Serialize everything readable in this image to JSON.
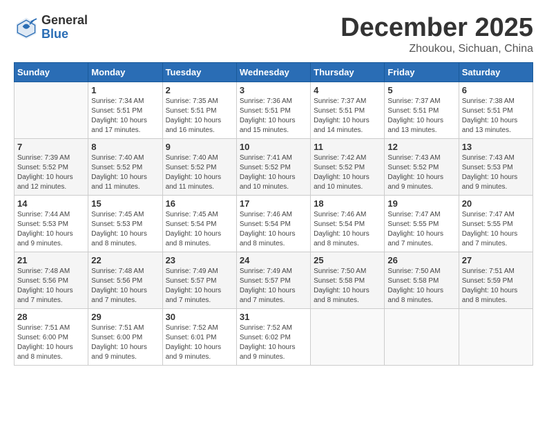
{
  "logo": {
    "general": "General",
    "blue": "Blue"
  },
  "title": {
    "month": "December 2025",
    "location": "Zhoukou, Sichuan, China"
  },
  "weekdays": [
    "Sunday",
    "Monday",
    "Tuesday",
    "Wednesday",
    "Thursday",
    "Friday",
    "Saturday"
  ],
  "weeks": [
    [
      {
        "day": "",
        "info": ""
      },
      {
        "day": "1",
        "info": "Sunrise: 7:34 AM\nSunset: 5:51 PM\nDaylight: 10 hours\nand 17 minutes."
      },
      {
        "day": "2",
        "info": "Sunrise: 7:35 AM\nSunset: 5:51 PM\nDaylight: 10 hours\nand 16 minutes."
      },
      {
        "day": "3",
        "info": "Sunrise: 7:36 AM\nSunset: 5:51 PM\nDaylight: 10 hours\nand 15 minutes."
      },
      {
        "day": "4",
        "info": "Sunrise: 7:37 AM\nSunset: 5:51 PM\nDaylight: 10 hours\nand 14 minutes."
      },
      {
        "day": "5",
        "info": "Sunrise: 7:37 AM\nSunset: 5:51 PM\nDaylight: 10 hours\nand 13 minutes."
      },
      {
        "day": "6",
        "info": "Sunrise: 7:38 AM\nSunset: 5:51 PM\nDaylight: 10 hours\nand 13 minutes."
      }
    ],
    [
      {
        "day": "7",
        "info": "Sunrise: 7:39 AM\nSunset: 5:52 PM\nDaylight: 10 hours\nand 12 minutes."
      },
      {
        "day": "8",
        "info": "Sunrise: 7:40 AM\nSunset: 5:52 PM\nDaylight: 10 hours\nand 11 minutes."
      },
      {
        "day": "9",
        "info": "Sunrise: 7:40 AM\nSunset: 5:52 PM\nDaylight: 10 hours\nand 11 minutes."
      },
      {
        "day": "10",
        "info": "Sunrise: 7:41 AM\nSunset: 5:52 PM\nDaylight: 10 hours\nand 10 minutes."
      },
      {
        "day": "11",
        "info": "Sunrise: 7:42 AM\nSunset: 5:52 PM\nDaylight: 10 hours\nand 10 minutes."
      },
      {
        "day": "12",
        "info": "Sunrise: 7:43 AM\nSunset: 5:52 PM\nDaylight: 10 hours\nand 9 minutes."
      },
      {
        "day": "13",
        "info": "Sunrise: 7:43 AM\nSunset: 5:53 PM\nDaylight: 10 hours\nand 9 minutes."
      }
    ],
    [
      {
        "day": "14",
        "info": "Sunrise: 7:44 AM\nSunset: 5:53 PM\nDaylight: 10 hours\nand 9 minutes."
      },
      {
        "day": "15",
        "info": "Sunrise: 7:45 AM\nSunset: 5:53 PM\nDaylight: 10 hours\nand 8 minutes."
      },
      {
        "day": "16",
        "info": "Sunrise: 7:45 AM\nSunset: 5:54 PM\nDaylight: 10 hours\nand 8 minutes."
      },
      {
        "day": "17",
        "info": "Sunrise: 7:46 AM\nSunset: 5:54 PM\nDaylight: 10 hours\nand 8 minutes."
      },
      {
        "day": "18",
        "info": "Sunrise: 7:46 AM\nSunset: 5:54 PM\nDaylight: 10 hours\nand 8 minutes."
      },
      {
        "day": "19",
        "info": "Sunrise: 7:47 AM\nSunset: 5:55 PM\nDaylight: 10 hours\nand 7 minutes."
      },
      {
        "day": "20",
        "info": "Sunrise: 7:47 AM\nSunset: 5:55 PM\nDaylight: 10 hours\nand 7 minutes."
      }
    ],
    [
      {
        "day": "21",
        "info": "Sunrise: 7:48 AM\nSunset: 5:56 PM\nDaylight: 10 hours\nand 7 minutes."
      },
      {
        "day": "22",
        "info": "Sunrise: 7:48 AM\nSunset: 5:56 PM\nDaylight: 10 hours\nand 7 minutes."
      },
      {
        "day": "23",
        "info": "Sunrise: 7:49 AM\nSunset: 5:57 PM\nDaylight: 10 hours\nand 7 minutes."
      },
      {
        "day": "24",
        "info": "Sunrise: 7:49 AM\nSunset: 5:57 PM\nDaylight: 10 hours\nand 7 minutes."
      },
      {
        "day": "25",
        "info": "Sunrise: 7:50 AM\nSunset: 5:58 PM\nDaylight: 10 hours\nand 8 minutes."
      },
      {
        "day": "26",
        "info": "Sunrise: 7:50 AM\nSunset: 5:58 PM\nDaylight: 10 hours\nand 8 minutes."
      },
      {
        "day": "27",
        "info": "Sunrise: 7:51 AM\nSunset: 5:59 PM\nDaylight: 10 hours\nand 8 minutes."
      }
    ],
    [
      {
        "day": "28",
        "info": "Sunrise: 7:51 AM\nSunset: 6:00 PM\nDaylight: 10 hours\nand 8 minutes."
      },
      {
        "day": "29",
        "info": "Sunrise: 7:51 AM\nSunset: 6:00 PM\nDaylight: 10 hours\nand 9 minutes."
      },
      {
        "day": "30",
        "info": "Sunrise: 7:52 AM\nSunset: 6:01 PM\nDaylight: 10 hours\nand 9 minutes."
      },
      {
        "day": "31",
        "info": "Sunrise: 7:52 AM\nSunset: 6:02 PM\nDaylight: 10 hours\nand 9 minutes."
      },
      {
        "day": "",
        "info": ""
      },
      {
        "day": "",
        "info": ""
      },
      {
        "day": "",
        "info": ""
      }
    ]
  ]
}
